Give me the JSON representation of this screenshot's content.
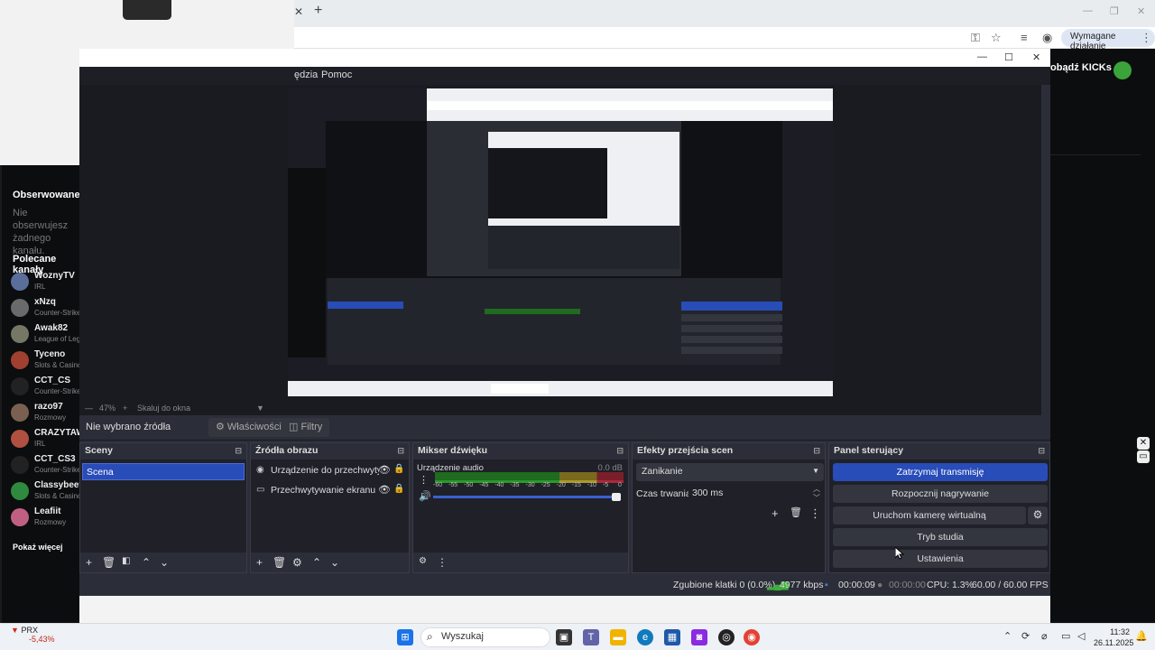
{
  "browser": {
    "required_action": "Wymagane działanie"
  },
  "kick": {
    "followed_title": "Obserwowane",
    "not_following": "Nie obserwujesz żadnego kanału.",
    "recommended_title": "Polecane kanały",
    "channels": [
      {
        "name": "WoznyTV",
        "category": "IRL",
        "color": "#5a6e9c"
      },
      {
        "name": "xNzq",
        "category": "Counter-Strike",
        "color": "#6a6a6a"
      },
      {
        "name": "Awak82",
        "category": "League of Legends",
        "color": "#777766"
      },
      {
        "name": "Tyceno",
        "category": "Slots & Casino",
        "color": "#a04030"
      },
      {
        "name": "CCT_CS",
        "category": "Counter-Strike",
        "color": "#222222"
      },
      {
        "name": "razo97",
        "category": "Rozmowy",
        "color": "#7a6050"
      },
      {
        "name": "CRAZYTAW",
        "category": "IRL",
        "color": "#b05040"
      },
      {
        "name": "CCT_CS3",
        "category": "Counter-Strike",
        "color": "#222222"
      },
      {
        "name": "Classybeef",
        "category": "Slots & Casino",
        "color": "#2e8a3e"
      },
      {
        "name": "Leafiit",
        "category": "Rozmowy",
        "color": "#c06080"
      }
    ],
    "show_more": "Pokaż więcej",
    "cta": "obądź KICKs"
  },
  "obs": {
    "menu_items": [
      "ędzia",
      "Pomoc"
    ],
    "zoom": "47%",
    "fit_label": "Skaluj do okna",
    "no_source": "Nie wybrano źródła",
    "properties": "Właściwości",
    "filters": "Filtry",
    "scenes": {
      "title": "Sceny",
      "selected": "Scena"
    },
    "sources": {
      "title": "Źródła obrazu",
      "items": [
        "Urządzenie do przechwytywania obrazu",
        "Przechwytywanie ekranu"
      ]
    },
    "mixer": {
      "title": "Mikser dźwięku",
      "device": "Urządzenie audio",
      "db": "0.0 dB",
      "ticks": [
        "-60",
        "-55",
        "-50",
        "-45",
        "-40",
        "-35",
        "-30",
        "-25",
        "-20",
        "-15",
        "-10",
        "-5",
        "0"
      ]
    },
    "transitions": {
      "title": "Efekty przejścia scen",
      "selected": "Zanikanie",
      "duration_label": "Czas trwania",
      "duration_value": "300 ms"
    },
    "controls": {
      "title": "Panel sterujący",
      "stop_stream": "Zatrzymaj transmisję",
      "start_recording": "Rozpocznij nagrywanie",
      "virtual_cam": "Uruchom kamerę wirtualną",
      "studio_mode": "Tryb studia",
      "settings": "Ustawienia"
    },
    "status": {
      "dropped": "Zgubione klatki 0 (0.0%)",
      "bitrate": "4977 kbps",
      "stream_time": "00:00:09",
      "rec_time": "00:00:00",
      "cpu": "CPU: 1.3%",
      "fps": "60.00 / 60.00 FPS"
    }
  },
  "taskbar": {
    "stock_name": "PRX",
    "stock_change": "-5,43%",
    "search": "Wyszukaj",
    "time": "11:32",
    "date": "26.11.2025"
  }
}
